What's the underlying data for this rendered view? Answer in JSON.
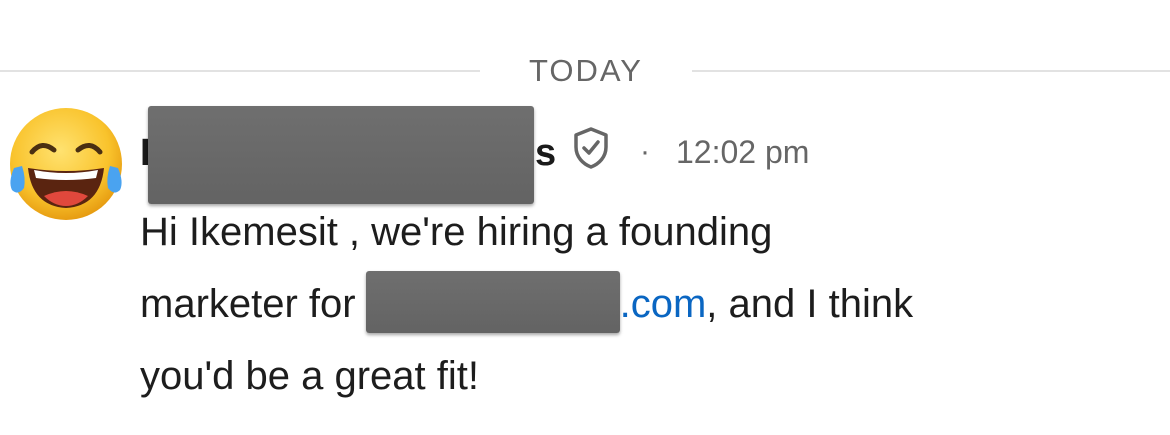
{
  "date_divider": "TODAY",
  "sender": {
    "name_visible_start": "I",
    "name_visible_end": "s",
    "timestamp": "12:02 pm",
    "separator": "·"
  },
  "message": {
    "line1": "Hi Ikemesit , we're hiring a founding",
    "line2_before": "marketer for",
    "line2_link": ".com",
    "line2_after": ", and I think",
    "line3": "you'd be a great fit!"
  },
  "icons": {
    "avatar": "face-with-tears-of-joy-emoji",
    "verified": "shield-check-icon"
  },
  "colors": {
    "link": "#0a66c2",
    "meta_text": "#666666",
    "redaction": "#686868"
  }
}
